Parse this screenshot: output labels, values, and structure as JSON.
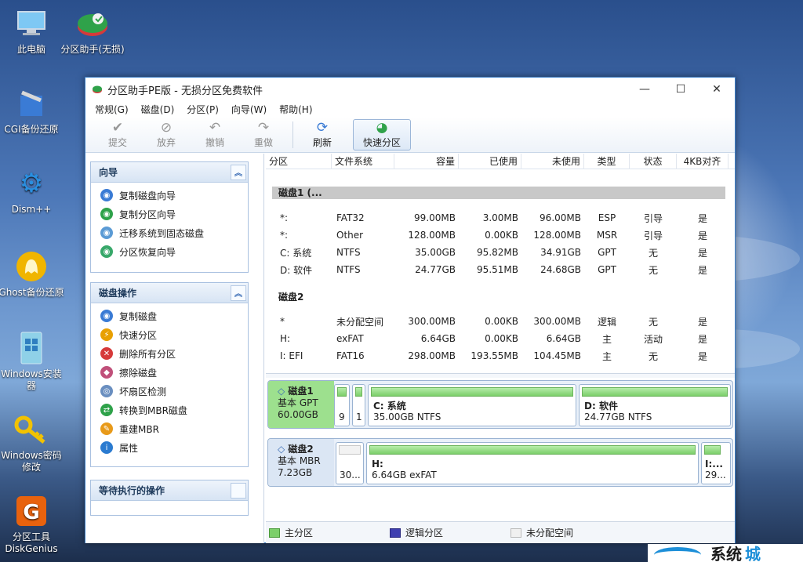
{
  "desktop": {
    "icons": [
      {
        "label": "此电脑",
        "icon": "computer-icon"
      },
      {
        "label": "分区助手(无损)",
        "icon": "partition-assistant-icon"
      },
      {
        "label": "CGI备份还原",
        "icon": "cgi-tool-icon"
      },
      {
        "label": "Dism++",
        "icon": "gear-icon"
      },
      {
        "label": "Ghost备份还原",
        "icon": "ghost-icon"
      },
      {
        "label": "Windows安装器",
        "icon": "windows-installer-icon"
      },
      {
        "label": "Windows密码修改",
        "icon": "key-icon"
      },
      {
        "label": "分区工具DiskGenius",
        "icon": "diskgenius-icon"
      }
    ]
  },
  "window": {
    "title": "分区助手PE版 - 无损分区免费软件",
    "controls": {
      "minimize": "—",
      "maximize": "☐",
      "close": "✕"
    }
  },
  "menu": [
    "常规(G)",
    "磁盘(D)",
    "分区(P)",
    "向导(W)",
    "帮助(H)"
  ],
  "toolbar": {
    "submit": "提交",
    "discard": "放弃",
    "undo": "撤销",
    "redo": "重做",
    "refresh": "刷新",
    "quick_partition": "快速分区"
  },
  "sidebar": {
    "wizard": {
      "title": "向导",
      "items": [
        "复制磁盘向导",
        "复制分区向导",
        "迁移系统到固态磁盘",
        "分区恢复向导"
      ]
    },
    "disk_ops": {
      "title": "磁盘操作",
      "items": [
        "复制磁盘",
        "快速分区",
        "删除所有分区",
        "擦除磁盘",
        "坏扇区检测",
        "转换到MBR磁盘",
        "重建MBR",
        "属性"
      ]
    },
    "pending": {
      "title": "等待执行的操作"
    }
  },
  "table": {
    "headers": [
      "分区",
      "文件系统",
      "容量",
      "已使用",
      "未使用",
      "类型",
      "状态",
      "4KB对齐"
    ],
    "disk1_title": "磁盘1 (...",
    "disk1_rows": [
      {
        "part": "*:",
        "fs": "FAT32",
        "cap": "99.00MB",
        "used": "3.00MB",
        "free": "96.00MB",
        "type": "ESP",
        "status": "引导",
        "align": "是"
      },
      {
        "part": "*:",
        "fs": "Other",
        "cap": "128.00MB",
        "used": "0.00KB",
        "free": "128.00MB",
        "type": "MSR",
        "status": "引导",
        "align": "是"
      },
      {
        "part": "C: 系统",
        "fs": "NTFS",
        "cap": "35.00GB",
        "used": "95.82MB",
        "free": "34.91GB",
        "type": "GPT",
        "status": "无",
        "align": "是"
      },
      {
        "part": "D: 软件",
        "fs": "NTFS",
        "cap": "24.77GB",
        "used": "95.51MB",
        "free": "24.68GB",
        "type": "GPT",
        "status": "无",
        "align": "是"
      }
    ],
    "disk2_title": "磁盘2",
    "disk2_rows": [
      {
        "part": "*",
        "fs": "未分配空间",
        "cap": "300.00MB",
        "used": "0.00KB",
        "free": "300.00MB",
        "type": "逻辑",
        "status": "无",
        "align": "是"
      },
      {
        "part": "H:",
        "fs": "exFAT",
        "cap": "6.64GB",
        "used": "0.00KB",
        "free": "6.64GB",
        "type": "主",
        "status": "活动",
        "align": "是"
      },
      {
        "part": "I: EFI",
        "fs": "FAT16",
        "cap": "298.00MB",
        "used": "193.55MB",
        "free": "104.45MB",
        "type": "主",
        "status": "无",
        "align": "是"
      }
    ]
  },
  "diskmap": {
    "disk1": {
      "name": "磁盘1",
      "kind": "基本 GPT",
      "size": "60.00GB",
      "p1": "9",
      "p2": "1",
      "c_name": "C: 系统",
      "c_info": "35.00GB NTFS",
      "d_name": "D: 软件",
      "d_info": "24.77GB NTFS"
    },
    "disk2": {
      "name": "磁盘2",
      "kind": "基本 MBR",
      "size": "7.23GB",
      "un": "30...",
      "h_name": "H:",
      "h_info": "6.64GB exFAT",
      "i_name": "I:...",
      "i_info": "29..."
    }
  },
  "legend": [
    "主分区",
    "逻辑分区",
    "未分配空间"
  ],
  "colors": {
    "primary": "#7ccf6a",
    "logical": "#3f3fb0",
    "unallocated": "#f0f0f0",
    "accent": "#3a7bd5"
  },
  "watermark": {
    "a": "系统",
    "b": "城"
  }
}
